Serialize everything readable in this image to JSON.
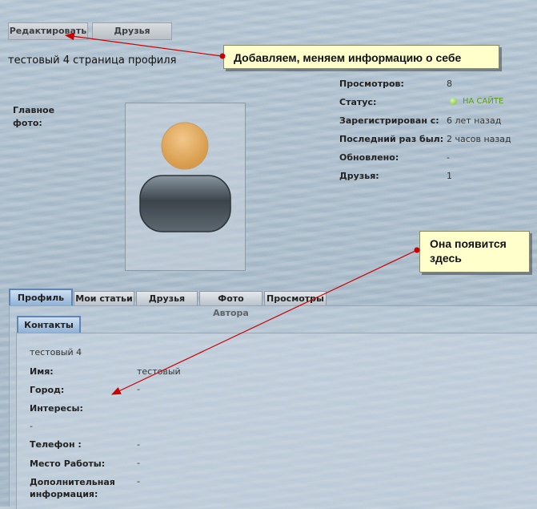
{
  "top_buttons": {
    "edit": "Редактировать",
    "friends": "Друзья"
  },
  "page_title": "тестовый 4 страница профиля",
  "callouts": {
    "top": "Добавляем, меняем информацию о себе",
    "bottom": "Она появится здесь"
  },
  "main_photo_label": "Главное фото:",
  "stats": [
    {
      "label": "Просмотров:",
      "value": "8"
    },
    {
      "label": "Статус:",
      "value": "НА САЙТЕ"
    },
    {
      "label": "Зарегистрирован с:",
      "value": "6 лет назад"
    },
    {
      "label": "Последний раз был:",
      "value": "2 часов назад"
    },
    {
      "label": "Обновлено:",
      "value": "-"
    },
    {
      "label": "Друзья:",
      "value": "1"
    }
  ],
  "tabs": [
    "Профиль",
    "Мои статьи",
    "Друзья",
    "Фото Автора",
    "Просмотры"
  ],
  "subtab": "Контакты",
  "contacts": {
    "name_line": "тестовый 4",
    "rows": [
      {
        "label": "Имя:",
        "value": "тестовый"
      },
      {
        "label": "Город:",
        "value": "-"
      },
      {
        "label": "Интересы:",
        "value": ""
      },
      {
        "label": "",
        "value": "-"
      },
      {
        "label": "Телефон :",
        "value": "-"
      },
      {
        "label": "Место Работы:",
        "value": "-"
      },
      {
        "label": "Дополнительная информация:",
        "value": "-"
      }
    ]
  },
  "colors": {
    "online": "#5a9a1a",
    "callout_bg": "#ffffcc",
    "arrow": "#cc0000",
    "active_tab": "#8fb2d6"
  },
  "icons": [
    "online-dot-icon",
    "avatar-placeholder-icon",
    "arrow-icon"
  ]
}
